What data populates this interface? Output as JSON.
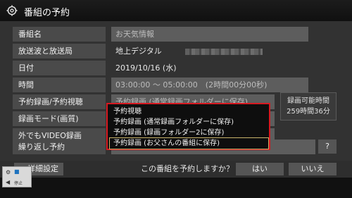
{
  "window": {
    "title": "番組の予約"
  },
  "form": {
    "rows": [
      {
        "label": "番組名",
        "value": "お天気情報"
      },
      {
        "label": "放送波と放送局",
        "value": "地上デジタル"
      },
      {
        "label": "日付",
        "value": "2019/10/16 (水)"
      },
      {
        "label": "時間",
        "value": "03:00:00 ～ 05:00:00　(2時間00分00秒)"
      },
      {
        "label": "予約録画/予約視聴",
        "value": "予約録画 (通常録画フォルダーに保存)"
      },
      {
        "label": "録画モード(画質)",
        "value": ""
      },
      {
        "label": "外でもVIDEO録画",
        "value": ""
      },
      {
        "label": "繰り返し予約",
        "value": ""
      }
    ]
  },
  "side_info": {
    "line1": "録画可能時間",
    "line2": "259時間36分"
  },
  "help_button": "?",
  "dropdown": {
    "options": [
      "予約視聴",
      "予約録画 (通常録画フォルダーに保存)",
      "予約録画 (録画フォルダー2に保存)",
      "予約録画 (お父さんの番組に保存)"
    ],
    "selected_index": 3
  },
  "footer": {
    "details_button": "詳細設定",
    "prompt": "この番組を予約しますか？",
    "yes_button": "はい",
    "no_button": "いいえ"
  },
  "widget": {
    "label": "停止"
  },
  "colors": {
    "dropdown_border": "#d71920",
    "selected_outline": "#c8b26a"
  }
}
